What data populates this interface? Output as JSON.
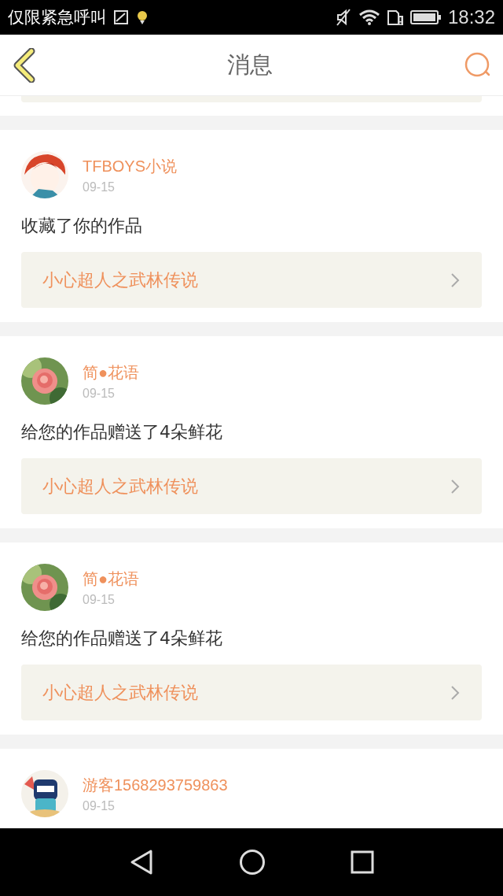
{
  "status_bar": {
    "carrier": "仅限紧急呼叫",
    "time": "18:32"
  },
  "header": {
    "title": "消息"
  },
  "messages": [
    {
      "name": "TFBOYS小说",
      "date": "09-15",
      "text": "收藏了你的作品",
      "book": "小心超人之武林传说"
    },
    {
      "name": "简●花语",
      "date": "09-15",
      "text": "给您的作品赠送了4朵鲜花",
      "book": "小心超人之武林传说"
    },
    {
      "name": "简●花语",
      "date": "09-15",
      "text": "给您的作品赠送了4朵鲜花",
      "book": "小心超人之武林传说"
    },
    {
      "name": "游客1568293759863",
      "date": "09-15"
    }
  ]
}
